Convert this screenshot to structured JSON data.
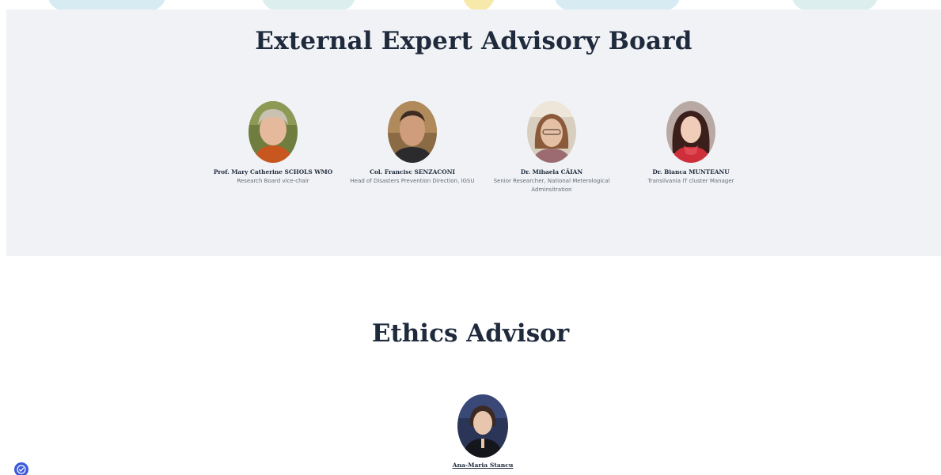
{
  "advisory_board": {
    "title": "External Expert Advisory Board",
    "members": [
      {
        "name": "Prof. Mary Catherine SCHOLS WMO",
        "role": "Research Board vice-chair"
      },
      {
        "name": "Col. Francisc SENZACONI",
        "role": "Head of Disasters Prevention Direction, IGSU"
      },
      {
        "name": "Dr. Mihaela CĂIAN",
        "role": "Senior Researcher, National Meterological Adminsitration"
      },
      {
        "name": "Dr. Bianca MUNTEANU",
        "role": "Transilvania IT cluster Manager"
      }
    ]
  },
  "ethics": {
    "title": "Ethics Advisor",
    "member": {
      "name": "Ana-Maria Stancu"
    }
  },
  "accessibility": {
    "icon": "accessibility-icon"
  },
  "colors": {
    "section_bg": "#f0f2f5",
    "heading": "#1f2a3c",
    "role_text": "#666e78",
    "accessibility_button": "#3b5bdb"
  }
}
